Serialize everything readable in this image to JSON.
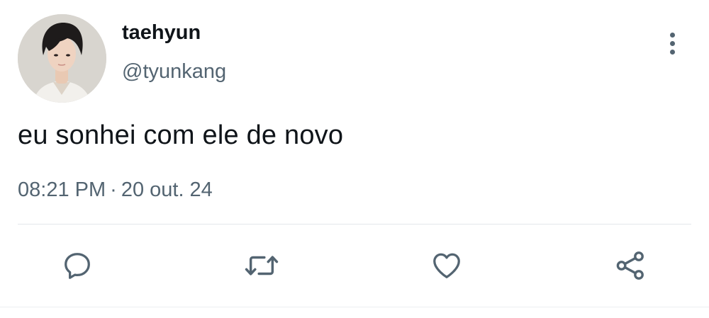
{
  "tweet": {
    "display_name": "taehyun",
    "handle": "@tyunkang",
    "text": "eu sonhei com ele de novo",
    "time": "08:21 PM",
    "separator": "·",
    "date": "20 out. 24"
  },
  "icons": {
    "more": "more-vertical-icon",
    "reply": "reply-icon",
    "retweet": "retweet-icon",
    "like": "heart-icon",
    "share": "share-icon"
  },
  "colors": {
    "text_primary": "#0f1419",
    "text_secondary": "#536471",
    "divider": "#e3e7ea"
  }
}
